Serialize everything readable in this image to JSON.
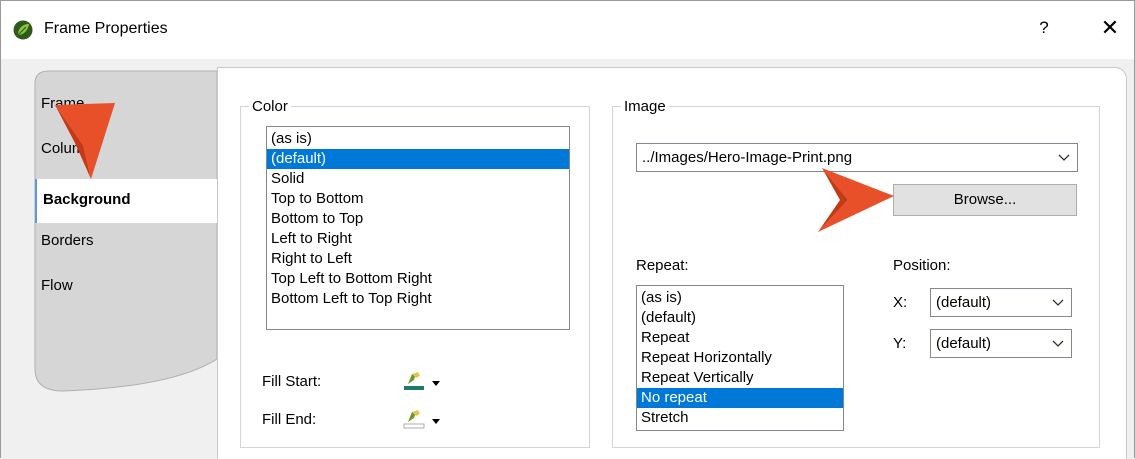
{
  "window": {
    "title": "Frame Properties",
    "help_label": "?",
    "close_label": "✕"
  },
  "tabs": [
    {
      "label": "Frame"
    },
    {
      "label": "Columns"
    },
    {
      "label": "Background"
    },
    {
      "label": "Borders"
    },
    {
      "label": "Flow"
    }
  ],
  "active_tab": "Background",
  "color_group": {
    "legend": "Color",
    "options": [
      "(as is)",
      "(default)",
      "Solid",
      "Top to Bottom",
      "Bottom to Top",
      "Left to Right",
      "Right to Left",
      "Top Left to Bottom Right",
      "Bottom Left to Top Right"
    ],
    "selected": "(default)",
    "fill_start_label": "Fill Start:",
    "fill_end_label": "Fill End:"
  },
  "image_group": {
    "legend": "Image",
    "path_value": "../Images/Hero-Image-Print.png",
    "browse_label": "Browse...",
    "repeat_label": "Repeat:",
    "repeat_options": [
      "(as is)",
      "(default)",
      "Repeat",
      "Repeat Horizontally",
      "Repeat Vertically",
      "No repeat",
      "Stretch"
    ],
    "repeat_selected": "No repeat",
    "position_label": "Position:",
    "x_label": "X:",
    "x_value": "(default)",
    "y_label": "Y:",
    "y_value": "(default)"
  },
  "colors": {
    "selection": "#0078d7",
    "callout_arrow": "#e8502a",
    "active_tab_accent": "#5b9bd5"
  }
}
